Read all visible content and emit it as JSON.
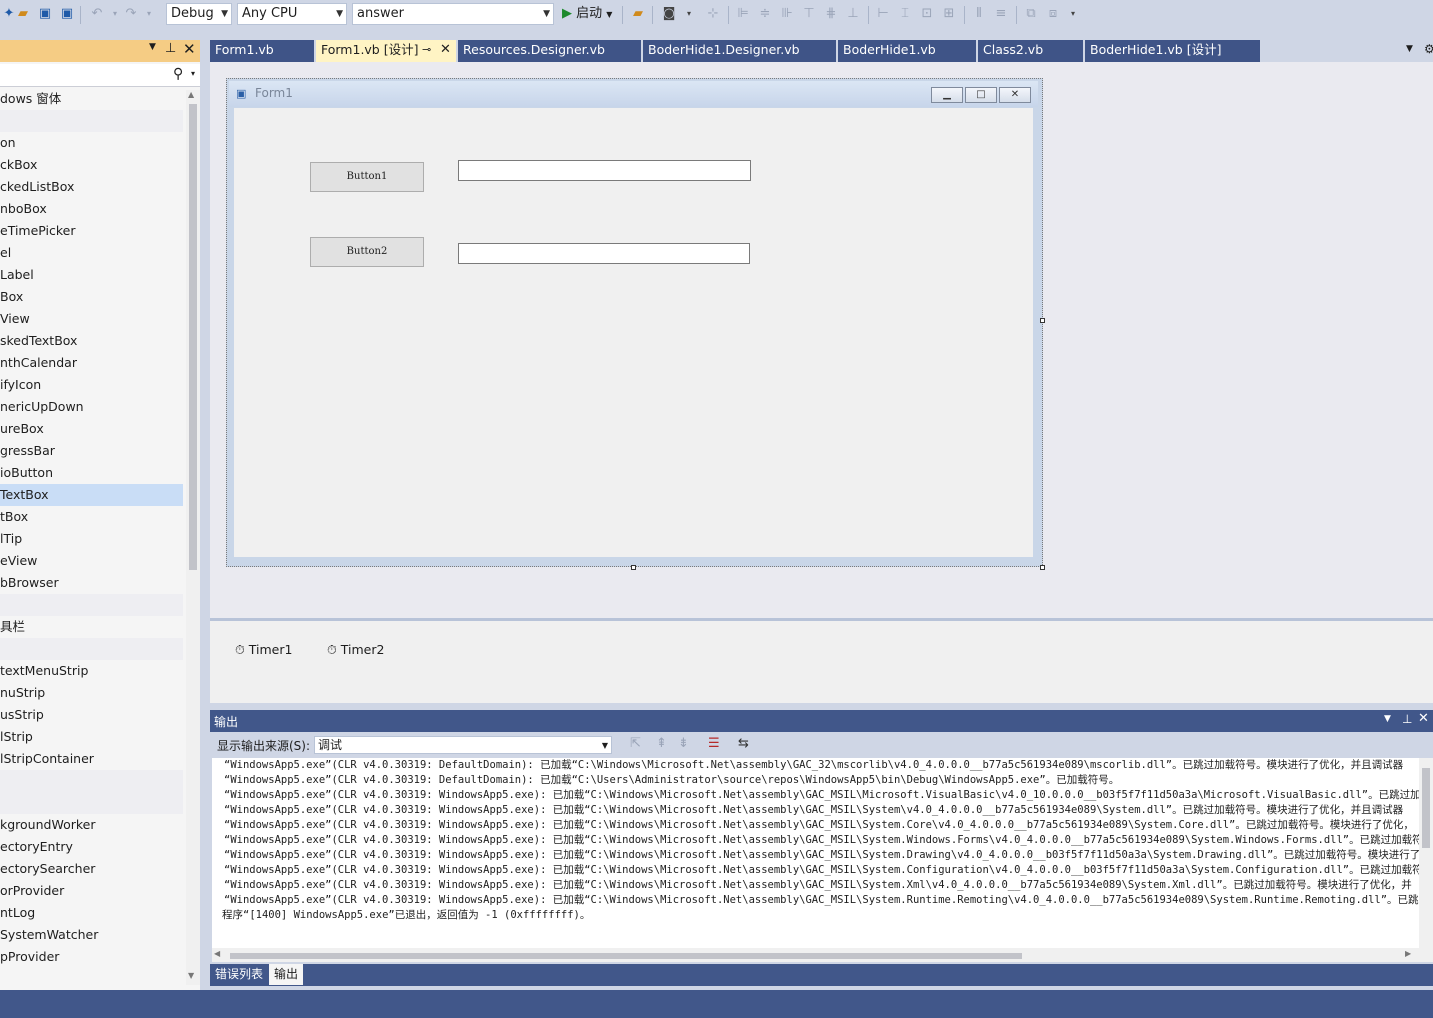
{
  "toolbar": {
    "config": "Debug",
    "platform": "Any CPU",
    "project": "answer",
    "start_label": "启动"
  },
  "toolbox": {
    "items": [
      {
        "label": "dows 窗体",
        "type": "header"
      },
      {
        "label": "",
        "type": "sep"
      },
      {
        "label": "on"
      },
      {
        "label": "ckBox"
      },
      {
        "label": "ckedListBox"
      },
      {
        "label": "nboBox"
      },
      {
        "label": "eTimePicker"
      },
      {
        "label": "el"
      },
      {
        "label": "Label"
      },
      {
        "label": "Box"
      },
      {
        "label": "View"
      },
      {
        "label": "skedTextBox"
      },
      {
        "label": "nthCalendar"
      },
      {
        "label": "ifyIcon"
      },
      {
        "label": "nericUpDown"
      },
      {
        "label": "ureBox"
      },
      {
        "label": "gressBar"
      },
      {
        "label": "ioButton"
      },
      {
        "label": "TextBox",
        "selected": true
      },
      {
        "label": "tBox"
      },
      {
        "label": "lTip"
      },
      {
        "label": "eView"
      },
      {
        "label": "bBrowser"
      },
      {
        "label": "",
        "type": "sep"
      },
      {
        "label": "具栏",
        "type": "header"
      },
      {
        "label": "",
        "type": "sep"
      },
      {
        "label": "textMenuStrip"
      },
      {
        "label": "nuStrip"
      },
      {
        "label": "usStrip"
      },
      {
        "label": "lStrip"
      },
      {
        "label": "lStripContainer"
      },
      {
        "label": "",
        "type": "sep"
      },
      {
        "label": "",
        "type": "sep"
      },
      {
        "label": "kgroundWorker"
      },
      {
        "label": "ectoryEntry"
      },
      {
        "label": "ectorySearcher"
      },
      {
        "label": "orProvider"
      },
      {
        "label": "ntLog"
      },
      {
        "label": "SystemWatcher"
      },
      {
        "label": "pProvider"
      }
    ]
  },
  "tabs": [
    {
      "label": "Form1.vb",
      "active": false
    },
    {
      "label": "Form1.vb [设计]",
      "active": true
    },
    {
      "label": "Resources.Designer.vb",
      "active": false
    },
    {
      "label": "BoderHide1.Designer.vb",
      "active": false
    },
    {
      "label": "BoderHide1.vb",
      "active": false
    },
    {
      "label": "Class2.vb",
      "active": false
    },
    {
      "label": "BoderHide1.vb [设计]",
      "active": false
    }
  ],
  "form": {
    "title": "Form1",
    "button1": "Button1",
    "button2": "Button2"
  },
  "tray": {
    "items": [
      "Timer1",
      "Timer2"
    ]
  },
  "output": {
    "title": "输出",
    "source_label": "显示输出来源(S):",
    "source_value": "调试",
    "lines": [
      "“WindowsApp5.exe”(CLR v4.0.30319: DefaultDomain): 已加载“C:\\Windows\\Microsoft.Net\\assembly\\GAC_32\\mscorlib\\v4.0_4.0.0.0__b77a5c561934e089\\mscorlib.dll”。已跳过加载符号。模块进行了优化，并且调试器",
      "“WindowsApp5.exe”(CLR v4.0.30319: DefaultDomain): 已加载“C:\\Users\\Administrator\\source\\repos\\WindowsApp5\\bin\\Debug\\WindowsApp5.exe”。已加载符号。",
      "“WindowsApp5.exe”(CLR v4.0.30319: WindowsApp5.exe): 已加载“C:\\Windows\\Microsoft.Net\\assembly\\GAC_MSIL\\Microsoft.VisualBasic\\v4.0_10.0.0.0__b03f5f7f11d50a3a\\Microsoft.VisualBasic.dll”。已跳过加载符",
      "“WindowsApp5.exe”(CLR v4.0.30319: WindowsApp5.exe): 已加载“C:\\Windows\\Microsoft.Net\\assembly\\GAC_MSIL\\System\\v4.0_4.0.0.0__b77a5c561934e089\\System.dll”。已跳过加载符号。模块进行了优化，并且调试器",
      "“WindowsApp5.exe”(CLR v4.0.30319: WindowsApp5.exe): 已加载“C:\\Windows\\Microsoft.Net\\assembly\\GAC_MSIL\\System.Core\\v4.0_4.0.0.0__b77a5c561934e089\\System.Core.dll”。已跳过加载符号。模块进行了优化，",
      "“WindowsApp5.exe”(CLR v4.0.30319: WindowsApp5.exe): 已加载“C:\\Windows\\Microsoft.Net\\assembly\\GAC_MSIL\\System.Windows.Forms\\v4.0_4.0.0.0__b77a5c561934e089\\System.Windows.Forms.dll”。已跳过加载符号",
      "“WindowsApp5.exe”(CLR v4.0.30319: WindowsApp5.exe): 已加载“C:\\Windows\\Microsoft.Net\\assembly\\GAC_MSIL\\System.Drawing\\v4.0_4.0.0.0__b03f5f7f11d50a3a\\System.Drawing.dll”。已跳过加载符号。模块进行了",
      "“WindowsApp5.exe”(CLR v4.0.30319: WindowsApp5.exe): 已加载“C:\\Windows\\Microsoft.Net\\assembly\\GAC_MSIL\\System.Configuration\\v4.0_4.0.0.0__b03f5f7f11d50a3a\\System.Configuration.dll”。已跳过加载符号",
      "“WindowsApp5.exe”(CLR v4.0.30319: WindowsApp5.exe): 已加载“C:\\Windows\\Microsoft.Net\\assembly\\GAC_MSIL\\System.Xml\\v4.0_4.0.0.0__b77a5c561934e089\\System.Xml.dll”。已跳过加载符号。模块进行了优化，并",
      "“WindowsApp5.exe”(CLR v4.0.30319: WindowsApp5.exe): 已加载“C:\\Windows\\Microsoft.Net\\assembly\\GAC_MSIL\\System.Runtime.Remoting\\v4.0_4.0.0.0__b77a5c561934e089\\System.Runtime.Remoting.dll”。已跳过加",
      "程序“[1400] WindowsApp5.exe”已退出，返回值为 -1 (0xffffffff)。"
    ]
  },
  "bottom_tabs": [
    {
      "label": "错误列表",
      "active": false
    },
    {
      "label": "输出",
      "active": true
    }
  ]
}
